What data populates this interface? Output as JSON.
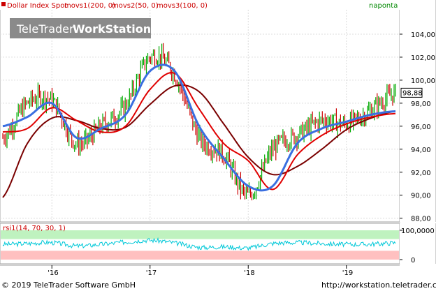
{
  "legend": {
    "name": "Dollar Index Spot",
    "ma1": "movs1(200, 0)",
    "ma2": "movs2(50, 0)",
    "ma3": "movs3(100, 0)",
    "source": "naponta"
  },
  "watermark": {
    "part1": "TeleTrader",
    "part2": "WorkStation"
  },
  "last_price_label": "98,88",
  "rsi_label": "rsi1(14, 70, 30, 1)",
  "footer": {
    "copyright": "© 2019 TeleTrader Software GmbH",
    "url": "http://workstation.teletrader.com"
  },
  "colors": {
    "price_up": "#00aa00",
    "price_down": "#cc0000",
    "ma200": "#7a0000",
    "ma50": "#3a6fe0",
    "ma100": "#e00000",
    "rsi_line": "#00c8d8",
    "rsi_upper_band": "#bff2bf",
    "rsi_lower_band": "#ffc0c0",
    "legend_red": "#cc0000",
    "legend_green": "#008800"
  },
  "chart_data": [
    {
      "type": "line",
      "title": "Dollar Index Spot",
      "x": [
        "2015-07",
        "2015-10",
        "2016-01",
        "2016-04",
        "2016-07",
        "2016-10",
        "2017-01",
        "2017-04",
        "2017-07",
        "2017-10",
        "2018-01",
        "2018-04",
        "2018-07",
        "2018-10",
        "2019-01",
        "2019-04",
        "2019-06"
      ],
      "xtick_labels": [
        "'16",
        "'17",
        "'18",
        "'19"
      ],
      "ylim": [
        87.8,
        106.0
      ],
      "yticks": [
        88,
        90,
        92,
        94,
        96,
        98,
        100,
        102,
        104
      ],
      "ytick_labels": [
        "88,00",
        "90,00",
        "92,00",
        "94,00",
        "96,00",
        "98,00",
        "100,00",
        "102,00",
        "104,00"
      ],
      "grid": true,
      "last_value": 98.88,
      "series": [
        {
          "name": "Dollar Index Spot",
          "values": [
            95.0,
            98.0,
            98.2,
            94.5,
            96.0,
            97.8,
            102.0,
            100.5,
            95.0,
            93.5,
            90.0,
            94.0,
            95.2,
            96.5,
            96.2,
            97.4,
            98.88
          ]
        },
        {
          "name": "movs1(200, 0)",
          "values": [
            89.8,
            94.5,
            96.7,
            96.5,
            95.8,
            95.9,
            97.9,
            99.5,
            99.0,
            96.2,
            93.3,
            91.8,
            92.5,
            94.0,
            95.7,
            96.7,
            97.3
          ]
        },
        {
          "name": "movs2(50, 0)",
          "values": [
            96.0,
            96.8,
            98.0,
            95.0,
            95.8,
            97.0,
            100.8,
            100.8,
            96.0,
            93.2,
            90.8,
            90.8,
            94.5,
            95.8,
            96.4,
            97.0,
            97.3
          ]
        },
        {
          "name": "movs3(100, 0)",
          "values": [
            95.5,
            95.8,
            97.6,
            96.5,
            95.5,
            96.0,
            99.2,
            100.6,
            97.5,
            94.5,
            93.0,
            90.5,
            93.5,
            95.2,
            96.2,
            96.8,
            97.1
          ]
        }
      ]
    },
    {
      "type": "line",
      "title": "rsi1(14, 70, 30, 1)",
      "ylim": [
        0,
        100
      ],
      "yticks": [
        0,
        100
      ],
      "ytick_labels": [
        "0",
        "100,0000"
      ],
      "bands": [
        30,
        70
      ],
      "series": [
        {
          "name": "rsi1(14, 70, 30, 1)",
          "values": [
            52,
            55,
            58,
            47,
            52,
            60,
            66,
            57,
            42,
            44,
            40,
            55,
            58,
            55,
            52,
            53,
            57
          ]
        }
      ]
    }
  ]
}
